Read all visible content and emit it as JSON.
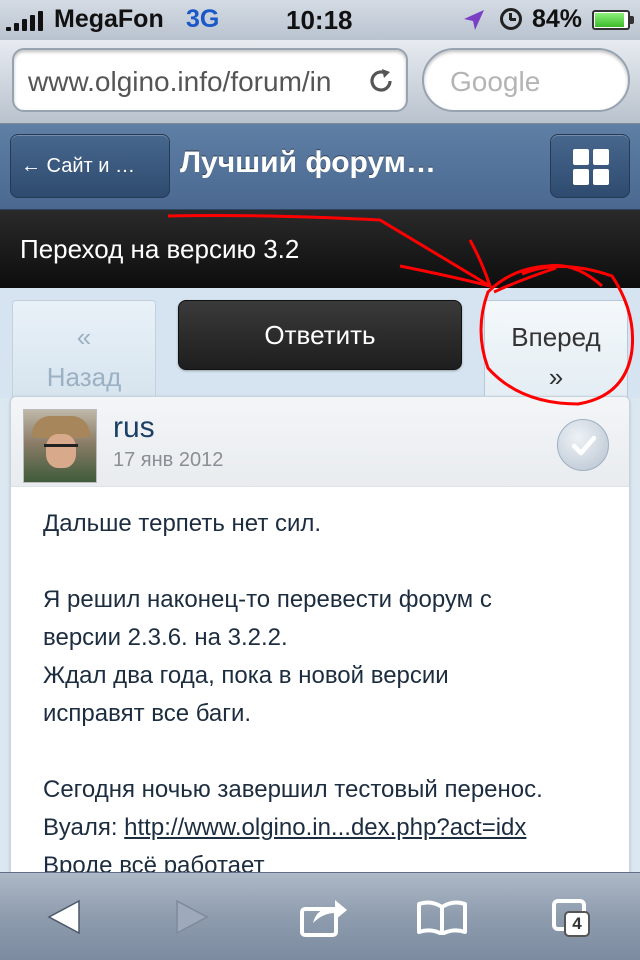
{
  "status_bar": {
    "carrier": "MegaFon",
    "network": "3G",
    "time": "10:18",
    "battery_percent": "84%",
    "battery_level": 0.84
  },
  "browser": {
    "address_text": "www.olgino.info/forum/in",
    "search_placeholder": "Google"
  },
  "forum_header": {
    "back_label": "← Сайт и …",
    "title": "Лучший форум…"
  },
  "topic": {
    "title": "Переход на версию 3.2"
  },
  "pager": {
    "prev_arrow": "«",
    "prev_label": "Назад",
    "reply_label": "Ответить",
    "next_label": "Вперед",
    "next_arrow": "»"
  },
  "post": {
    "author": "rus",
    "date": "17 янв 2012",
    "paragraph1": "Дальше терпеть нет сил.",
    "paragraph2_line1": "Я решил наконец-то перевести форум с",
    "paragraph2_line2": "версии 2.3.6. на 3.2.2.",
    "paragraph2_line3": "Ждал два года, пока в новой версии",
    "paragraph2_line4": "исправят все баги.",
    "paragraph3_line1": "Сегодня ночью завершил тестовый перенос.",
    "paragraph3_prefix": "Вуаля: ",
    "paragraph3_link": "http://www.olgino.in...dex.php?act=idx",
    "paragraph3_line3": "Вроде всё работает"
  },
  "toolbar": {
    "tab_count": "4"
  },
  "colors": {
    "annotation": "#ff0000",
    "header": "#4f6e95",
    "accent": "#1b3f66"
  }
}
